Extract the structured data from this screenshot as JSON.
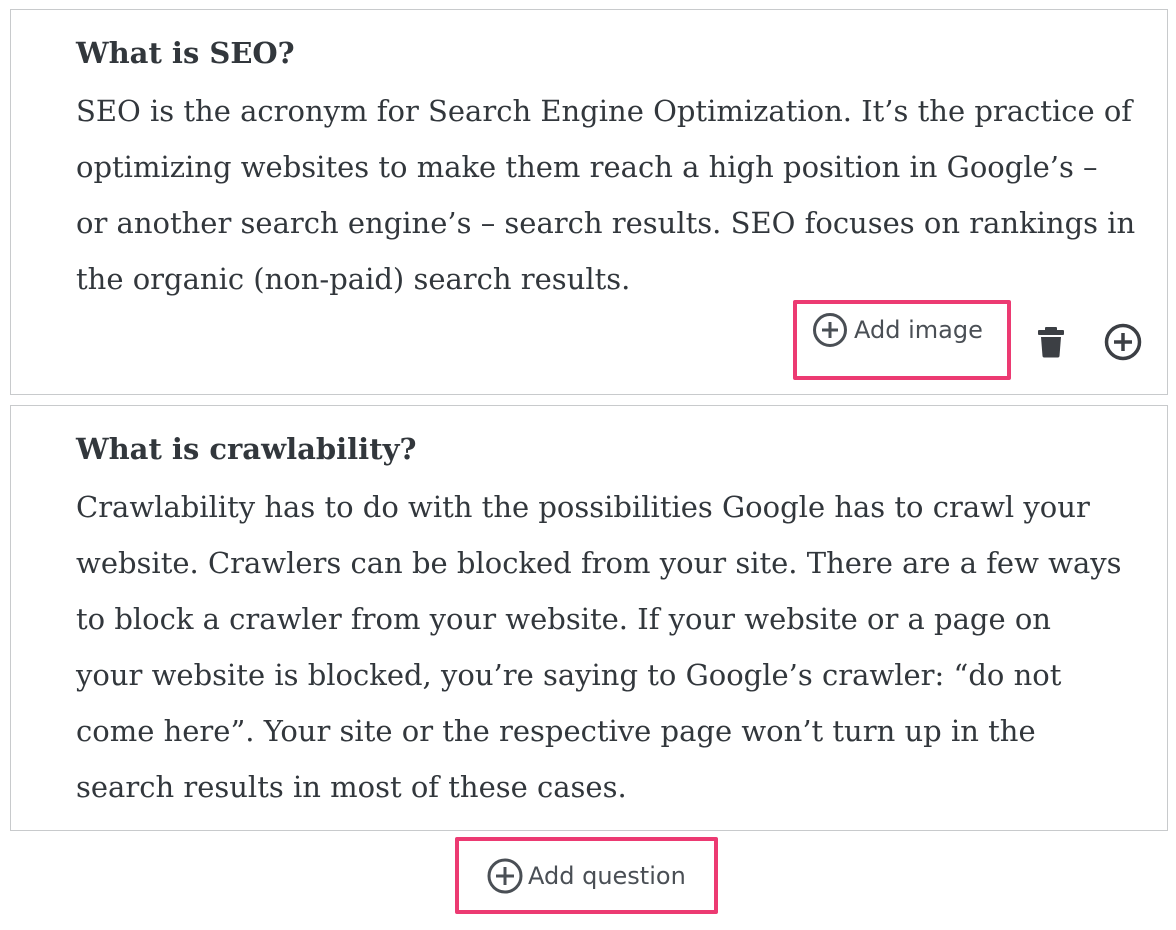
{
  "faq": [
    {
      "question": "What is SEO?",
      "answer": "SEO is the acronym for Search Engine Optimization. It’s the  practice of\noptimizing websites to make them reach a high position in Google’s –\nor another search engine’s – search results. SEO focuses on rankings in\nthe organic (non-paid) search results."
    },
    {
      "question": "What is crawlability?",
      "answer": "Crawlability has to do with the possibilities Google has to crawl your\nwebsite. Crawlers can be blocked from your site. There are a few ways\nto block a crawler from your website. If your website or a page on\nyour website is blocked, you’re saying to Google’s crawler: “do not\ncome here”. Your site or the respective page won’t turn up in the\nsearch results in most of these cases."
    }
  ],
  "toolbar": {
    "add_image_label": "Add image",
    "delete_icon": "trash-icon",
    "insert_icon": "plus-circle-icon"
  },
  "footer": {
    "add_question_label": "Add question"
  },
  "colors": {
    "highlight": "#ec3a72",
    "text": "#32373c",
    "border": "#c8cacc",
    "icon": "#4a4f55"
  }
}
